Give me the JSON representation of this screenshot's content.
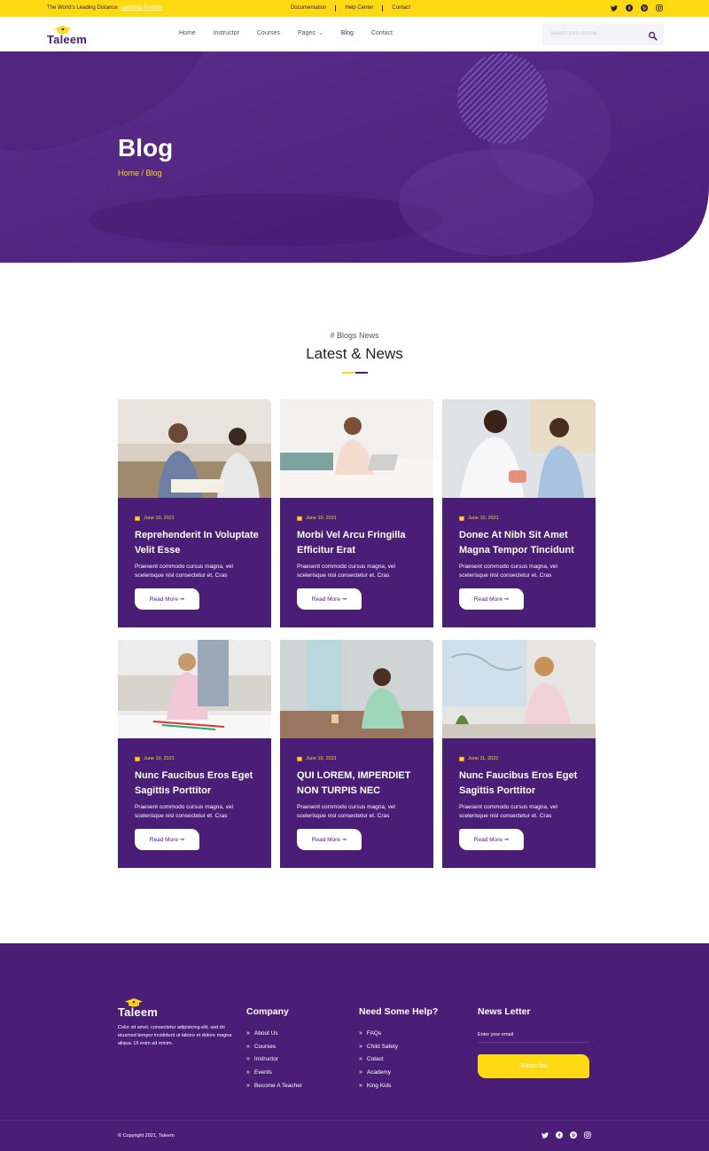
{
  "topbar": {
    "tagline": "The World's Leading Distance",
    "tagline_highlight": "Learning Provider",
    "links": [
      "Documentation",
      "Help Center",
      "Contact"
    ]
  },
  "nav": {
    "logo": "Taleem",
    "menu": [
      "Home",
      "Instructor",
      "Courses",
      "Pages",
      "Blog",
      "Contact"
    ],
    "active": "Blog",
    "search_placeholder": "Search your course"
  },
  "hero": {
    "title": "Blog",
    "breadcrumb": "Home / Blog"
  },
  "section": {
    "subtitle": "# Blogs News",
    "title": "Latest & News"
  },
  "posts": [
    {
      "date": "June 10, 2021",
      "title": "Reprehenderit In Voluptate Velit Esse",
      "excerpt": "Praesent commodo cursus magna, vel scelerisque nisl consectetur et. Cras",
      "button": "Read More ➞"
    },
    {
      "date": "June 10, 2021",
      "title": "Morbi Vel Arcu Fringilla Efficitur Erat",
      "excerpt": "Praesent commodo cursus magna, vel scelerisque nisl consectetur et. Cras",
      "button": "Read More ➞"
    },
    {
      "date": "June 10, 2021",
      "title": "Donec At Nibh Sit Amet Magna Tempor Tincidunt",
      "excerpt": "Praesent commodo cursus magna, vel scelerisque nisl consectetur et. Cras",
      "button": "Read More ➞"
    },
    {
      "date": "June 10, 2021",
      "title": "Nunc Faucibus Eros Eget Sagittis Porttitor",
      "excerpt": "Praesent commodo cursus magna, vel scelerisque nisl consectetur et. Cras",
      "button": "Read More ➞"
    },
    {
      "date": "June 10, 2021",
      "title": "QUI LOREM, IMPERDIET NON TURPIS NEC",
      "excerpt": "Praesent commodo cursus magna, vel scelerisque nisl consectetur et. Cras",
      "button": "Read More ➞"
    },
    {
      "date": "June 11, 2021",
      "title": "Nunc Faucibus Eros Eget Sagittis Porttitor",
      "excerpt": "Praesent commodo cursus magna, vel scelerisque nisl consectetur et. Cras",
      "button": "Read More ➞"
    }
  ],
  "footer": {
    "logo": "Taleem",
    "about": "Color sit amet, consectetur adipisicing elit, sed do eiusmod tempor incididunt ut labore et dolore magna aliqua. Ut enim ad minim.",
    "company_title": "Company",
    "company_links": [
      "About Us",
      "Courses",
      "Instructor",
      "Events",
      "Become A Teacher"
    ],
    "help_title": "Need Some Help?",
    "help_links": [
      "FAQs",
      "Child Safety",
      "Cotact",
      "Academy",
      "King Kids"
    ],
    "newsletter_title": "News Letter",
    "email_placeholder": "Enter your email",
    "subscribe": "Subscribe",
    "copyright": "© Copyright 2021, Taleem"
  },
  "colors": {
    "primary": "#4a1d77",
    "accent": "#FFD912"
  },
  "icons": [
    "twitter-icon",
    "facebook-icon",
    "pinterest-icon",
    "instagram-icon",
    "search-icon",
    "calendar-icon"
  ]
}
